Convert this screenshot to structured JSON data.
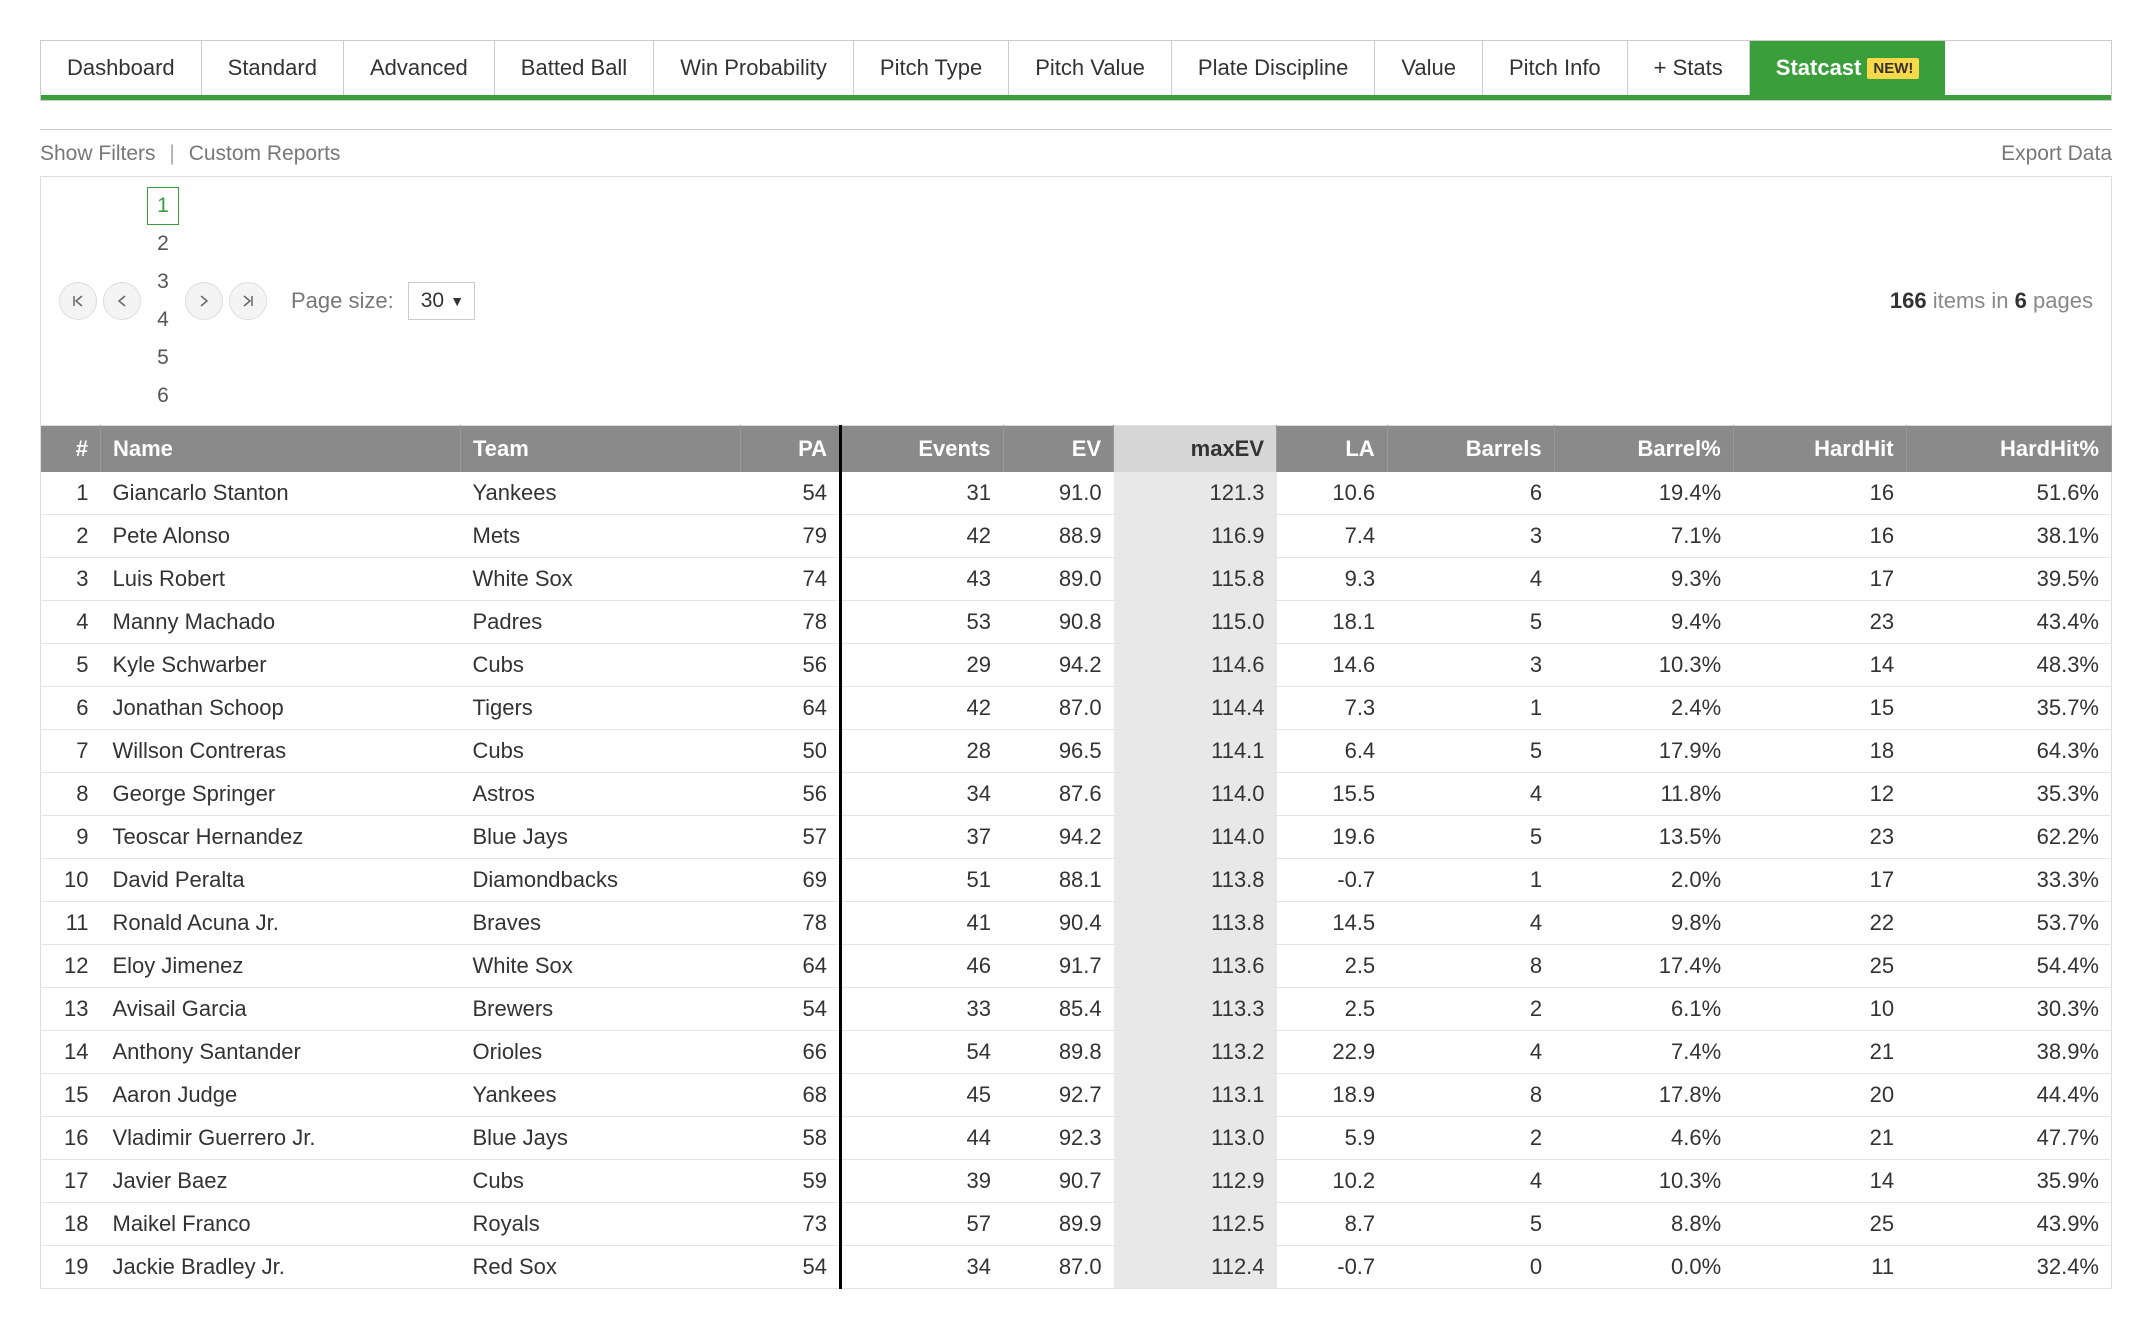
{
  "tabs": [
    {
      "label": "Dashboard"
    },
    {
      "label": "Standard"
    },
    {
      "label": "Advanced"
    },
    {
      "label": "Batted Ball"
    },
    {
      "label": "Win Probability"
    },
    {
      "label": "Pitch Type"
    },
    {
      "label": "Pitch Value"
    },
    {
      "label": "Plate Discipline"
    },
    {
      "label": "Value"
    },
    {
      "label": "Pitch Info"
    },
    {
      "label": "+ Stats"
    },
    {
      "label": "Statcast",
      "active": true,
      "badge": "NEW!"
    }
  ],
  "toolbar": {
    "show_filters": "Show Filters",
    "custom_reports": "Custom Reports",
    "export": "Export Data"
  },
  "pager": {
    "pages": [
      "1",
      "2",
      "3",
      "4",
      "5",
      "6"
    ],
    "current": "1",
    "page_size_label": "Page size:",
    "page_size_value": "30",
    "total_items": "166",
    "items_word": "items in",
    "total_pages": "6",
    "pages_word": "pages"
  },
  "columns": {
    "idx": "#",
    "name": "Name",
    "team": "Team",
    "pa": "PA",
    "events": "Events",
    "ev": "EV",
    "maxev": "maxEV",
    "la": "LA",
    "barrels": "Barrels",
    "barrelpct": "Barrel%",
    "hardhit": "HardHit",
    "hardhitpct": "HardHit%"
  },
  "rows": [
    {
      "idx": "1",
      "name": "Giancarlo Stanton",
      "team": "Yankees",
      "pa": "54",
      "events": "31",
      "ev": "91.0",
      "maxev": "121.3",
      "la": "10.6",
      "barrels": "6",
      "barrelpct": "19.4%",
      "hardhit": "16",
      "hardhitpct": "51.6%"
    },
    {
      "idx": "2",
      "name": "Pete Alonso",
      "team": "Mets",
      "pa": "79",
      "events": "42",
      "ev": "88.9",
      "maxev": "116.9",
      "la": "7.4",
      "barrels": "3",
      "barrelpct": "7.1%",
      "hardhit": "16",
      "hardhitpct": "38.1%"
    },
    {
      "idx": "3",
      "name": "Luis Robert",
      "team": "White Sox",
      "pa": "74",
      "events": "43",
      "ev": "89.0",
      "maxev": "115.8",
      "la": "9.3",
      "barrels": "4",
      "barrelpct": "9.3%",
      "hardhit": "17",
      "hardhitpct": "39.5%"
    },
    {
      "idx": "4",
      "name": "Manny Machado",
      "team": "Padres",
      "pa": "78",
      "events": "53",
      "ev": "90.8",
      "maxev": "115.0",
      "la": "18.1",
      "barrels": "5",
      "barrelpct": "9.4%",
      "hardhit": "23",
      "hardhitpct": "43.4%"
    },
    {
      "idx": "5",
      "name": "Kyle Schwarber",
      "team": "Cubs",
      "pa": "56",
      "events": "29",
      "ev": "94.2",
      "maxev": "114.6",
      "la": "14.6",
      "barrels": "3",
      "barrelpct": "10.3%",
      "hardhit": "14",
      "hardhitpct": "48.3%"
    },
    {
      "idx": "6",
      "name": "Jonathan Schoop",
      "team": "Tigers",
      "pa": "64",
      "events": "42",
      "ev": "87.0",
      "maxev": "114.4",
      "la": "7.3",
      "barrels": "1",
      "barrelpct": "2.4%",
      "hardhit": "15",
      "hardhitpct": "35.7%"
    },
    {
      "idx": "7",
      "name": "Willson Contreras",
      "team": "Cubs",
      "pa": "50",
      "events": "28",
      "ev": "96.5",
      "maxev": "114.1",
      "la": "6.4",
      "barrels": "5",
      "barrelpct": "17.9%",
      "hardhit": "18",
      "hardhitpct": "64.3%"
    },
    {
      "idx": "8",
      "name": "George Springer",
      "team": "Astros",
      "pa": "56",
      "events": "34",
      "ev": "87.6",
      "maxev": "114.0",
      "la": "15.5",
      "barrels": "4",
      "barrelpct": "11.8%",
      "hardhit": "12",
      "hardhitpct": "35.3%"
    },
    {
      "idx": "9",
      "name": "Teoscar Hernandez",
      "team": "Blue Jays",
      "pa": "57",
      "events": "37",
      "ev": "94.2",
      "maxev": "114.0",
      "la": "19.6",
      "barrels": "5",
      "barrelpct": "13.5%",
      "hardhit": "23",
      "hardhitpct": "62.2%"
    },
    {
      "idx": "10",
      "name": "David Peralta",
      "team": "Diamondbacks",
      "pa": "69",
      "events": "51",
      "ev": "88.1",
      "maxev": "113.8",
      "la": "-0.7",
      "barrels": "1",
      "barrelpct": "2.0%",
      "hardhit": "17",
      "hardhitpct": "33.3%"
    },
    {
      "idx": "11",
      "name": "Ronald Acuna Jr.",
      "team": "Braves",
      "pa": "78",
      "events": "41",
      "ev": "90.4",
      "maxev": "113.8",
      "la": "14.5",
      "barrels": "4",
      "barrelpct": "9.8%",
      "hardhit": "22",
      "hardhitpct": "53.7%"
    },
    {
      "idx": "12",
      "name": "Eloy Jimenez",
      "team": "White Sox",
      "pa": "64",
      "events": "46",
      "ev": "91.7",
      "maxev": "113.6",
      "la": "2.5",
      "barrels": "8",
      "barrelpct": "17.4%",
      "hardhit": "25",
      "hardhitpct": "54.4%"
    },
    {
      "idx": "13",
      "name": "Avisail Garcia",
      "team": "Brewers",
      "pa": "54",
      "events": "33",
      "ev": "85.4",
      "maxev": "113.3",
      "la": "2.5",
      "barrels": "2",
      "barrelpct": "6.1%",
      "hardhit": "10",
      "hardhitpct": "30.3%"
    },
    {
      "idx": "14",
      "name": "Anthony Santander",
      "team": "Orioles",
      "pa": "66",
      "events": "54",
      "ev": "89.8",
      "maxev": "113.2",
      "la": "22.9",
      "barrels": "4",
      "barrelpct": "7.4%",
      "hardhit": "21",
      "hardhitpct": "38.9%"
    },
    {
      "idx": "15",
      "name": "Aaron Judge",
      "team": "Yankees",
      "pa": "68",
      "events": "45",
      "ev": "92.7",
      "maxev": "113.1",
      "la": "18.9",
      "barrels": "8",
      "barrelpct": "17.8%",
      "hardhit": "20",
      "hardhitpct": "44.4%"
    },
    {
      "idx": "16",
      "name": "Vladimir Guerrero Jr.",
      "team": "Blue Jays",
      "pa": "58",
      "events": "44",
      "ev": "92.3",
      "maxev": "113.0",
      "la": "5.9",
      "barrels": "2",
      "barrelpct": "4.6%",
      "hardhit": "21",
      "hardhitpct": "47.7%"
    },
    {
      "idx": "17",
      "name": "Javier Baez",
      "team": "Cubs",
      "pa": "59",
      "events": "39",
      "ev": "90.7",
      "maxev": "112.9",
      "la": "10.2",
      "barrels": "4",
      "barrelpct": "10.3%",
      "hardhit": "14",
      "hardhitpct": "35.9%"
    },
    {
      "idx": "18",
      "name": "Maikel Franco",
      "team": "Royals",
      "pa": "73",
      "events": "57",
      "ev": "89.9",
      "maxev": "112.5",
      "la": "8.7",
      "barrels": "5",
      "barrelpct": "8.8%",
      "hardhit": "25",
      "hardhitpct": "43.9%"
    },
    {
      "idx": "19",
      "name": "Jackie Bradley Jr.",
      "team": "Red Sox",
      "pa": "54",
      "events": "34",
      "ev": "87.0",
      "maxev": "112.4",
      "la": "-0.7",
      "barrels": "0",
      "barrelpct": "0.0%",
      "hardhit": "11",
      "hardhitpct": "32.4%"
    }
  ]
}
